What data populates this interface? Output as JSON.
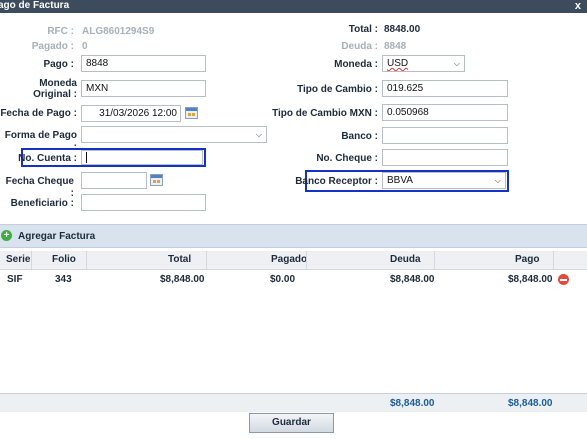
{
  "window": {
    "title": "ago de Factura",
    "close": "x"
  },
  "left": {
    "rfc_label": "RFC :",
    "rfc_value": "ALG8601294S9",
    "pagado_label": "Pagado :",
    "pagado_value": "0",
    "pago_label": "Pago :",
    "pago_value": "8848",
    "moneda_original_label_1": "Moneda",
    "moneda_original_label_2": "Original :",
    "moneda_original_value": "MXN",
    "fecha_pago_label": "Fecha de Pago :",
    "fecha_pago_value": "31/03/2026 12:00",
    "forma_pago_label": "Forma de Pago :",
    "forma_pago_value": "",
    "no_cuenta_label": "No. Cuenta :",
    "no_cuenta_value": "",
    "fecha_cheque_label": "Fecha Cheque :",
    "fecha_cheque_value": "",
    "beneficiario_label": "Beneficiario :",
    "beneficiario_value": ""
  },
  "right": {
    "total_label": "Total :",
    "total_value": "8848.00",
    "deuda_label": "Deuda :",
    "deuda_value": "8848",
    "moneda_label": "Moneda :",
    "moneda_value": "USD",
    "tipo_cambio_label": "Tipo de Cambio :",
    "tipo_cambio_value": "019.625",
    "tipo_cambio_mxn_label": "Tipo de Cambio MXN :",
    "tipo_cambio_mxn_value": "0.050968",
    "banco_label": "Banco :",
    "banco_value": "",
    "no_cheque_label": "No. Cheque :",
    "no_cheque_value": "",
    "banco_receptor_label": "Banco Receptor :",
    "banco_receptor_value": "BBVA"
  },
  "add_invoice": "Agregar Factura",
  "table": {
    "headers": [
      "Serie",
      "Folio",
      "Total",
      "Pagado",
      "Deuda",
      "Pago"
    ],
    "rows": [
      [
        "SIF",
        "343",
        "$8,848.00",
        "$0.00",
        "$8,848.00",
        "$8,848.00"
      ]
    ],
    "footer": {
      "deuda": "$8,848.00",
      "pago": "$8,848.00"
    }
  },
  "save_button": "Guardar",
  "icons": {
    "calendar": "calendar-icon",
    "add": "add-circle-icon",
    "remove": "remove-circle-icon",
    "dropdown": "chevron-down-icon"
  },
  "colors": {
    "title_bar": "#3d4c5c",
    "highlight": "#1431c8",
    "footer_totals": "#1a5d9b",
    "add_icon": "#3fae3f",
    "remove_icon": "#e24b3b"
  }
}
